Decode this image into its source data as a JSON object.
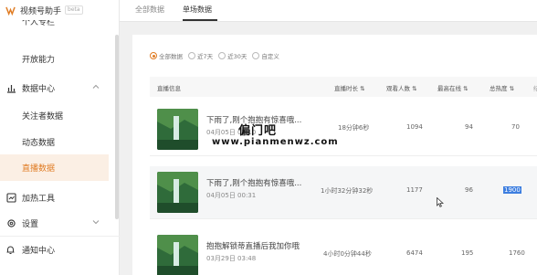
{
  "app": {
    "title": "视频号助手",
    "beta": "beta"
  },
  "sidebar": {
    "cut_item": "个人专栏",
    "items": [
      {
        "label": "开放能力"
      },
      {
        "label": "数据中心"
      },
      {
        "label": "关注者数据"
      },
      {
        "label": "动态数据"
      },
      {
        "label": "直播数据"
      },
      {
        "label": "加热工具"
      },
      {
        "label": "设置"
      }
    ],
    "bottom": "通知中心"
  },
  "tabs": [
    {
      "label": "全部数据"
    },
    {
      "label": "单场数据"
    }
  ],
  "filters": [
    {
      "label": "全部数据",
      "selected": true
    },
    {
      "label": "近7天",
      "selected": false
    },
    {
      "label": "近30天",
      "selected": false
    },
    {
      "label": "自定义",
      "selected": false
    }
  ],
  "table": {
    "headers": [
      "直播信息",
      "直播时长 ⇅",
      "观看人数 ⇅",
      "最高在线 ⇅",
      "总热度 ⇅"
    ],
    "rows": [
      {
        "title": "下雨了,刚个抱抱有惊喜哦...",
        "date": "04月05日 02:10",
        "duration": "18分钟6秒",
        "viewers": "1094",
        "peak": "94",
        "heat": "70"
      },
      {
        "title": "下雨了,刚个抱抱有惊喜哦...",
        "date": "04月05日 00:31",
        "duration": "1小时32分钟32秒",
        "viewers": "1177",
        "peak": "96",
        "heat": "1900"
      },
      {
        "title": "抱抱解锁蒂直播后我加你哦",
        "date": "03月29日 03:48",
        "duration": "4小时0分钟44秒",
        "viewers": "6474",
        "peak": "195",
        "heat": "1760"
      }
    ]
  },
  "watermark": {
    "line1": "偏门吧",
    "line2": "www.pianmenwz.com"
  },
  "colors": {
    "accent": "#e07c24",
    "selection": "#3d7ee0"
  }
}
